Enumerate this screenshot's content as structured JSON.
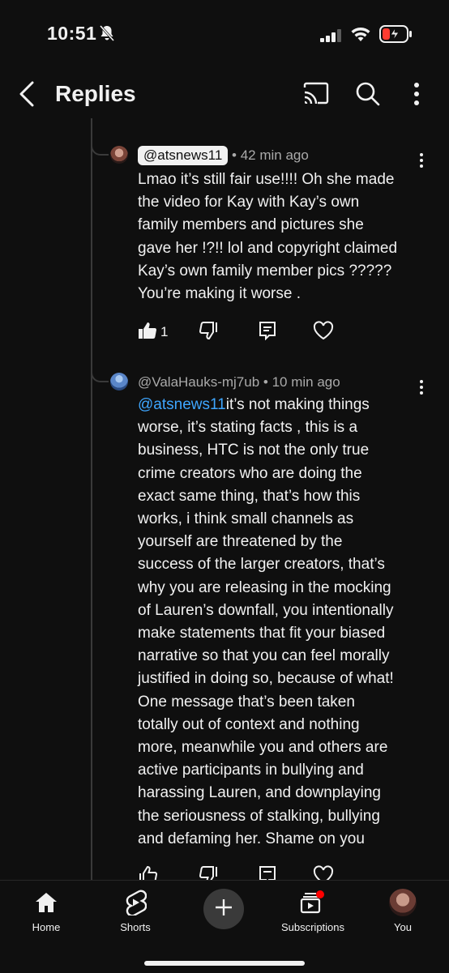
{
  "status_bar": {
    "time": "10:51",
    "icons": [
      "bell-slash-icon",
      "signal-icon",
      "wifi-icon",
      "battery-charging-icon"
    ]
  },
  "app_bar": {
    "title": "Replies",
    "icons": [
      "back-arrow-icon",
      "cast-icon",
      "search-icon",
      "more-vert-icon"
    ]
  },
  "replies": [
    {
      "handle": "@atsnews11",
      "separator": "•",
      "time_ago": "42 min ago",
      "lines": [
        "Lmao it’s still fair use!!!! Oh she made",
        "the video for Kay with Kay’s own",
        "family members and pictures she",
        "gave her !?!! lol and copyright claimed",
        "Kay’s own family member pics ?????",
        "You’re making it worse ."
      ],
      "like_count": "1"
    },
    {
      "handle": "@ValaHauks-mj7ub",
      "separator": "•",
      "time_ago": "10 min ago",
      "mention": "@atsnews11",
      "first_line_rest": "it’s not making things",
      "lines": [
        "worse, it’s stating facts , this is a",
        "business, HTC is not the only true",
        "crime creators who are doing the",
        "exact same thing, that’s how this",
        "works, i think small channels as",
        "yourself are threatened by the",
        "success of the larger creators, that’s",
        "why you are releasing in the mocking",
        "of Lauren’s downfall, you intentionally",
        "make statements that fit your biased",
        "narrative so that you can feel morally",
        "justified in doing so, because of what!",
        "One message that’s been taken",
        "totally out of context and nothing",
        "more, meanwhile you and others are",
        "active participants in bullying and",
        "harassing Lauren, and downplaying",
        "the seriousness of stalking, bullying",
        "and defaming her. Shame on you"
      ]
    }
  ],
  "bottom_nav": {
    "home": "Home",
    "shorts": "Shorts",
    "subscriptions": "Subscriptions",
    "you": "You"
  },
  "colors": {
    "background": "#0f0f0f",
    "text": "#f1f1f1",
    "secondary_text": "#aaaaaa",
    "mention": "#3ea6ff",
    "battery_low": "#ff3b30",
    "notification_dot": "#ff0000"
  }
}
